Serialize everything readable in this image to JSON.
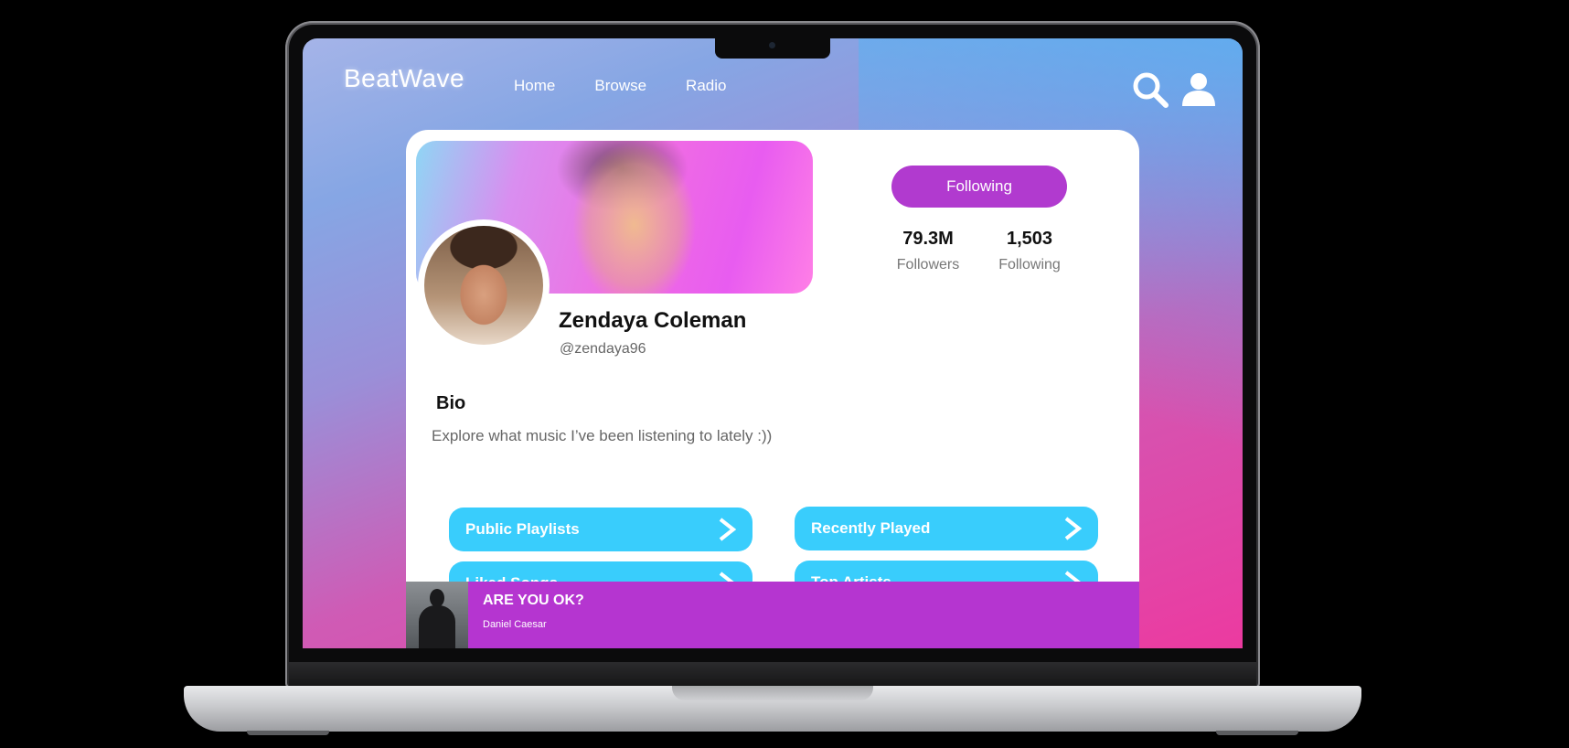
{
  "app": {
    "logo": "BeatWave"
  },
  "nav": {
    "items": [
      "Home",
      "Browse",
      "Radio"
    ]
  },
  "header_icons": [
    "search-icon",
    "user-icon"
  ],
  "profile": {
    "name": "Zendaya Coleman",
    "handle": "@zendaya96",
    "follow_button": "Following",
    "stats": {
      "followers_count": "79.3M",
      "followers_label": "Followers",
      "following_count": "1,503",
      "following_label": "Following"
    },
    "bio_title": "Bio",
    "bio_text": "Explore what music I’ve been listening to lately :))"
  },
  "links": [
    {
      "label": "Public Playlists"
    },
    {
      "label": "Recently Played"
    },
    {
      "label": "Liked Songs"
    },
    {
      "label": "Top Artists"
    }
  ],
  "now_playing": {
    "title": "ARE YOU OK?",
    "artist": "Daniel Caesar"
  },
  "colors": {
    "accent_purple": "#b13acf",
    "link_blue": "#39cdfc",
    "player_bar": "#b535d0"
  }
}
